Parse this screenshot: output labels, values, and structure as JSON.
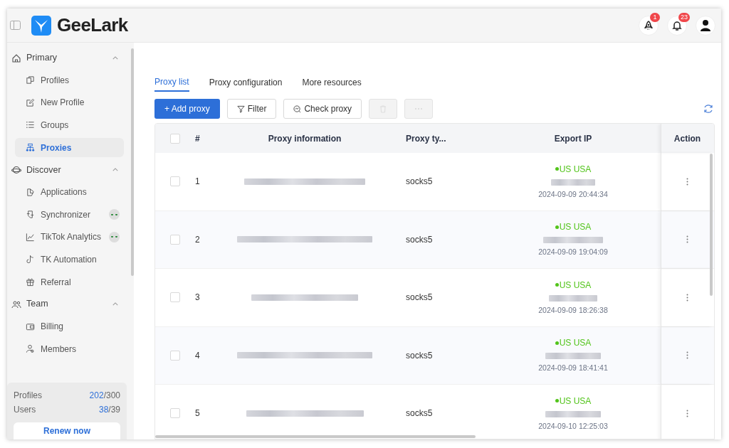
{
  "brand": "GeeLark",
  "header": {
    "notifications": [
      {
        "kind": "rocket",
        "count": "1"
      },
      {
        "kind": "bell",
        "count": "23"
      }
    ]
  },
  "sidebar": {
    "sections": [
      {
        "label": "Primary",
        "expanded": true,
        "items": [
          {
            "label": "Profiles",
            "selected": false,
            "badge": false
          },
          {
            "label": "New Profile",
            "selected": false,
            "badge": false
          },
          {
            "label": "Groups",
            "selected": false,
            "badge": false
          },
          {
            "label": "Proxies",
            "selected": true,
            "badge": false
          }
        ]
      },
      {
        "label": "Discover",
        "expanded": true,
        "items": [
          {
            "label": "Applications",
            "selected": false,
            "badge": false
          },
          {
            "label": "Synchronizer",
            "selected": false,
            "badge": true
          },
          {
            "label": "TikTok Analytics",
            "selected": false,
            "badge": true
          },
          {
            "label": "TK Automation",
            "selected": false,
            "badge": false
          },
          {
            "label": "Referral",
            "selected": false,
            "badge": false
          }
        ]
      },
      {
        "label": "Team",
        "expanded": true,
        "items": [
          {
            "label": "Billing",
            "selected": false,
            "badge": false
          },
          {
            "label": "Members",
            "selected": false,
            "badge": false
          }
        ]
      }
    ],
    "usage": [
      {
        "label": "Profiles",
        "used": "202",
        "total": "/300"
      },
      {
        "label": "Users",
        "used": "38",
        "total": "/39"
      }
    ],
    "renew_button": "Renew now"
  },
  "tabs": [
    {
      "label": "Proxy list",
      "selected": true
    },
    {
      "label": "Proxy configuration",
      "selected": false
    },
    {
      "label": "More resources",
      "selected": false
    }
  ],
  "toolbar": {
    "add_button": "+ Add proxy",
    "filter_button": "Filter",
    "check_button": "Check proxy",
    "delete_disabled": true,
    "more_disabled": true
  },
  "table": {
    "select_all_checked": false,
    "columns": [
      "#",
      "Proxy information",
      "Proxy ty...",
      "Export IP",
      "Action"
    ],
    "rows": [
      {
        "index": "1",
        "type": "socks5",
        "country": "US USA",
        "time": "2024-09-09 20:44:34",
        "checked": false
      },
      {
        "index": "2",
        "type": "socks5",
        "country": "US USA",
        "time": "2024-09-09 19:04:09",
        "checked": false
      },
      {
        "index": "3",
        "type": "socks5",
        "country": "US USA",
        "time": "2024-09-09 18:26:38",
        "checked": false
      },
      {
        "index": "4",
        "type": "socks5",
        "country": "US USA",
        "time": "2024-09-09 18:41:41",
        "checked": false
      },
      {
        "index": "5",
        "type": "socks5",
        "country": "US USA",
        "time": "2024-09-10 12:25:03",
        "checked": false
      }
    ]
  }
}
